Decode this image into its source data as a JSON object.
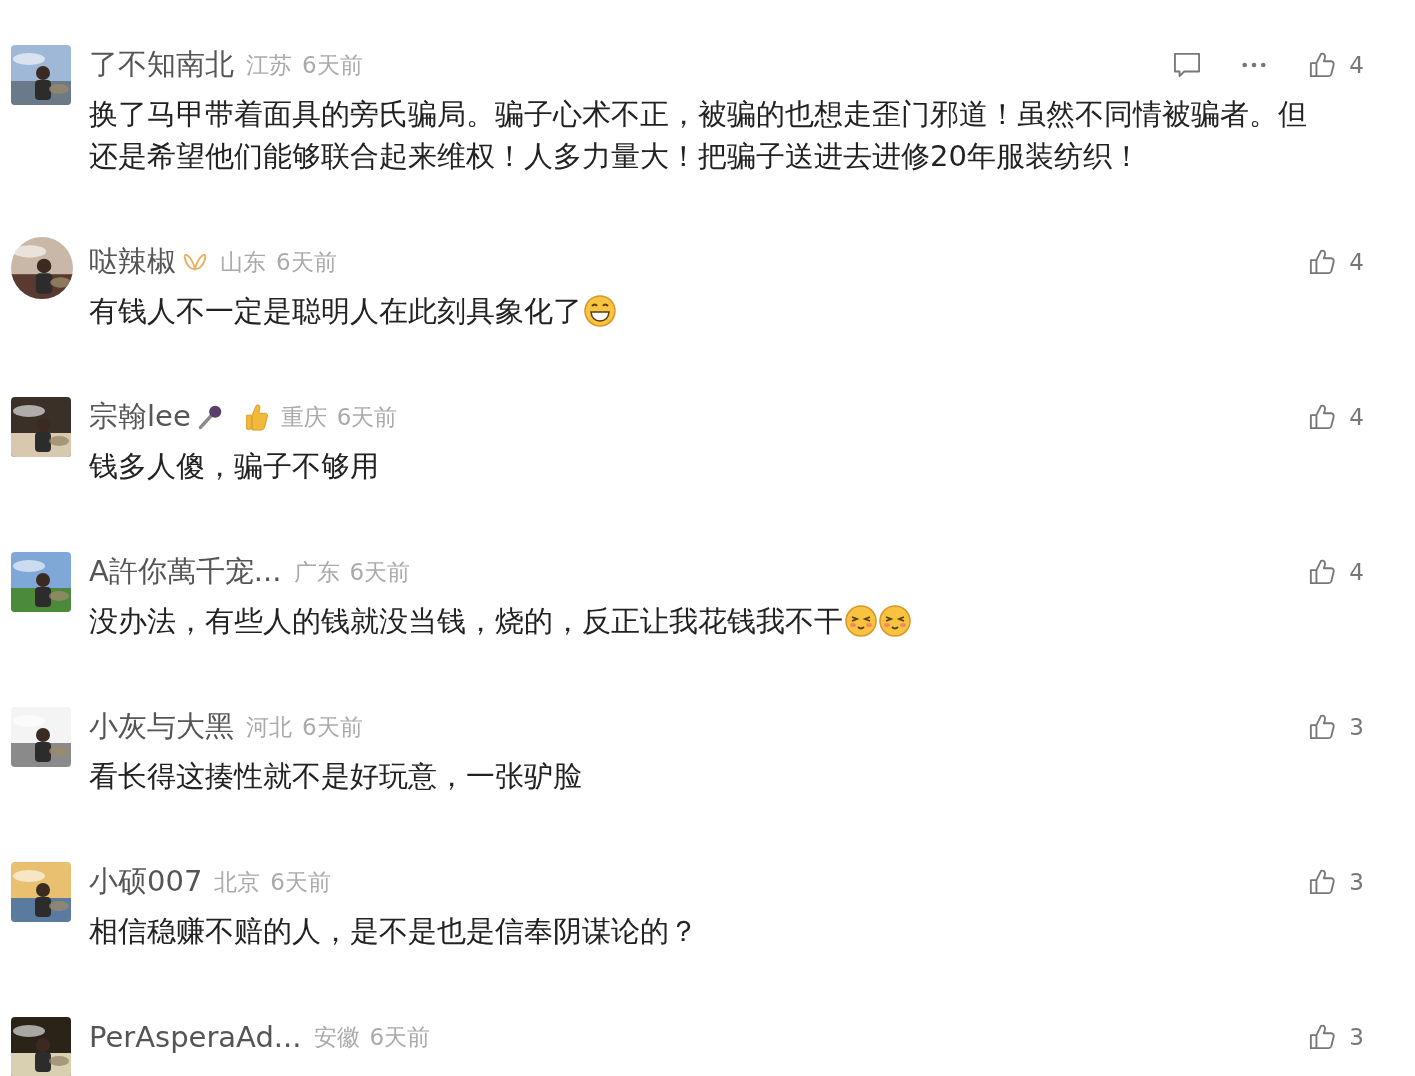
{
  "comments": [
    {
      "name": "了不知南北",
      "location": "江苏",
      "time": "6天前",
      "text": "换了马甲带着面具的旁氏骗局。骗子心术不正，被骗的也想走歪门邪道！虽然不同情被骗者。但还是希望他们能够联合起来维权！人多力量大！把骗子送进去进修20年服装纺织！",
      "likes": "4",
      "avatar": {
        "kind": "picture",
        "round": false
      },
      "show_actions": true
    },
    {
      "name": "哒辣椒",
      "location": "山东",
      "time": "6天前",
      "text": "有钱人不一定是聪明人在此刻具象化了",
      "likes": "4",
      "avatar": {
        "kind": "picture",
        "round": true
      },
      "badges": [
        {
          "kind": "butterfly"
        }
      ],
      "emojis": [
        {
          "kind": "grin"
        }
      ],
      "show_actions": false
    },
    {
      "name": "宗翰lee",
      "location": "重庆",
      "time": "6天前",
      "text": "钱多人傻，骗子不够用",
      "likes": "4",
      "avatar": {
        "kind": "picture",
        "round": false
      },
      "badges": [
        {
          "kind": "microphone"
        },
        {
          "kind": "thumbs-up"
        }
      ],
      "show_actions": false
    },
    {
      "name": "A許你萬千宠...",
      "location": "广东",
      "time": "6天前",
      "text": "没办法，有些人的钱就没当钱，烧的，反正让我花钱我不干",
      "likes": "4",
      "avatar": {
        "kind": "picture",
        "round": false
      },
      "emojis": [
        {
          "kind": "squint"
        },
        {
          "kind": "squint"
        }
      ],
      "show_actions": false
    },
    {
      "name": "小灰与大黑",
      "location": "河北",
      "time": "6天前",
      "text": "看长得这揍性就不是好玩意，一张驴脸",
      "likes": "3",
      "avatar": {
        "kind": "picture",
        "round": false
      },
      "show_actions": false
    },
    {
      "name": "小硕007",
      "location": "北京",
      "time": "6天前",
      "text": "相信稳赚不赔的人，是不是也是信奉阴谋论的？",
      "likes": "3",
      "avatar": {
        "kind": "picture",
        "round": false
      },
      "show_actions": false
    },
    {
      "name": "PerAsperaAd...",
      "location": "安徽",
      "time": "6天前",
      "likes": "3",
      "avatar": {
        "kind": "picture",
        "round": false
      },
      "show_actions": false
    }
  ]
}
